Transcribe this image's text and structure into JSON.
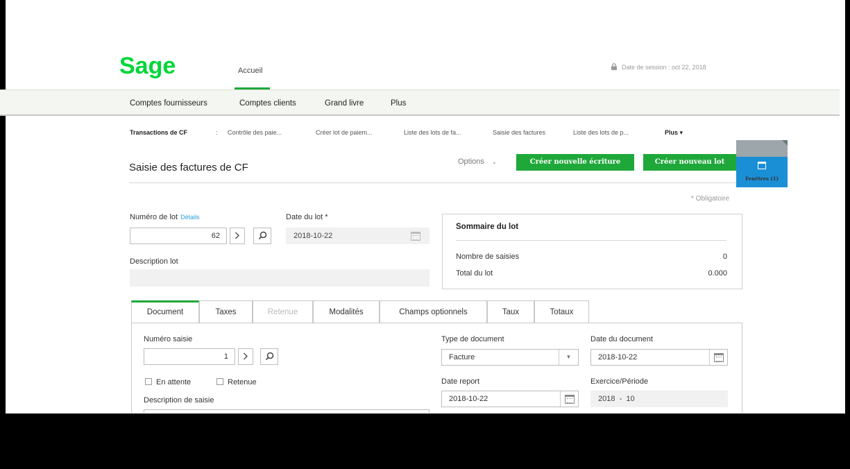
{
  "brand": {
    "name": "Sage",
    "color": "#00d639"
  },
  "header": {
    "tabs": [
      {
        "label": "Accueil",
        "active": true
      }
    ],
    "session": "Date de session : oct 22, 2018",
    "lock_icon": "lock-icon"
  },
  "menu": {
    "items": [
      "Comptes fournisseurs",
      "Comptes clients",
      "Grand livre",
      "Plus"
    ]
  },
  "subnav": {
    "section": "Transactions de CF",
    "separator": ":",
    "items": [
      "Contrôle des paie...",
      "Créer lot de paiem...",
      "Liste des lots de fa...",
      "Saisie des factures",
      "Liste des lots de p..."
    ],
    "more": "Plus ▾"
  },
  "page": {
    "title": "Saisie des factures de CF",
    "options": "Options",
    "options_icon": "chevron-down-icon",
    "btn_new_entry": "Créer nouvelle écriture",
    "btn_new_batch": "Créer nouveau lot",
    "required_note": "* Obligatoire",
    "accent": "#1fa83a"
  },
  "windows": {
    "label": "Fenêtres (1)",
    "color": "#1a8fd6"
  },
  "batch": {
    "number_label": "Numéro de lot",
    "details_link": "Détails",
    "number_value": "62",
    "date_label": "Date du lot *",
    "date_value": "2018-10-22",
    "description_label": "Description lot",
    "description_value": ""
  },
  "summary": {
    "title": "Sommaire du lot",
    "rows": [
      {
        "label": "Nombre de saisies",
        "value": "0"
      },
      {
        "label": "Total du lot",
        "value": "0.000"
      }
    ]
  },
  "tabs": [
    {
      "label": "Document",
      "active": true
    },
    {
      "label": "Taxes"
    },
    {
      "label": "Retenue",
      "disabled": true
    },
    {
      "label": "Modalités"
    },
    {
      "label": "Champs optionnels"
    },
    {
      "label": "Taux"
    },
    {
      "label": "Totaux"
    }
  ],
  "document": {
    "entry_number_label": "Numéro saisie",
    "entry_number_value": "1",
    "on_hold_label": "En attente",
    "retention_label": "Retenue",
    "entry_description_label": "Description de saisie",
    "doc_type_label": "Type de document",
    "doc_type_value": "Facture",
    "posting_date_label": "Date report",
    "posting_date_value": "2018-10-22",
    "doc_date_label": "Date du document",
    "doc_date_value": "2018-10-22",
    "fiscal_label": "Exercice/Période",
    "fiscal_value": "2018  -  10"
  }
}
